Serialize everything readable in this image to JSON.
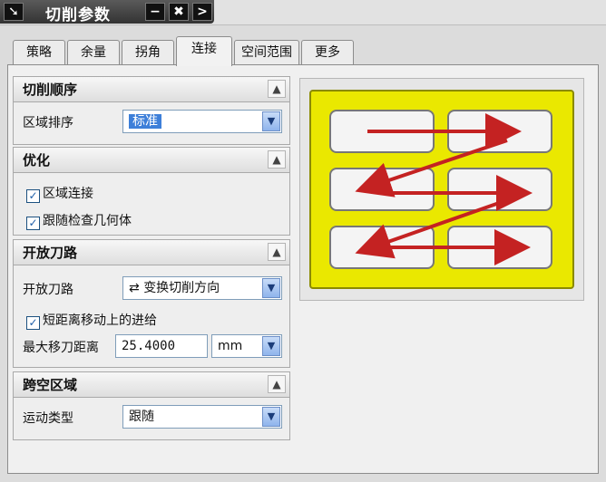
{
  "window": {
    "title": "切削参数",
    "pin_label": "➘",
    "minimize_label": "−",
    "close_label": "✖",
    "expand_label": ">"
  },
  "tabs": [
    {
      "label": "策略"
    },
    {
      "label": "余量"
    },
    {
      "label": "拐角"
    },
    {
      "label": "连接",
      "active": true
    },
    {
      "label": "空间范围"
    },
    {
      "label": "更多"
    }
  ],
  "sections": {
    "cut_order": {
      "title": "切削顺序",
      "region_sort": {
        "label": "区域排序",
        "value": "标准"
      }
    },
    "optimize": {
      "title": "优化",
      "checks": [
        {
          "label": "区域连接",
          "checked": true
        },
        {
          "label": "跟随检查几何体",
          "checked": true
        }
      ]
    },
    "open_path": {
      "title": "开放刀路",
      "path": {
        "label": "开放刀路",
        "value": "变换切削方向",
        "icon": "swap-direction-icon"
      },
      "short_move": {
        "label": "短距离移动上的进给",
        "checked": true
      },
      "max_move": {
        "label": "最大移刀距离",
        "value": "25.4000",
        "unit": "mm"
      }
    },
    "cross_void": {
      "title": "跨空区域",
      "motion_type": {
        "label": "运动类型",
        "value": "跟随"
      }
    }
  },
  "icons": {
    "collapse": "chevron-up-icon",
    "dropdown": "chevron-down-icon",
    "check": "checkmark-icon"
  },
  "colors": {
    "preview_bg": "#eae800",
    "arrow": "#c42222",
    "selection": "#3d7fd9"
  }
}
